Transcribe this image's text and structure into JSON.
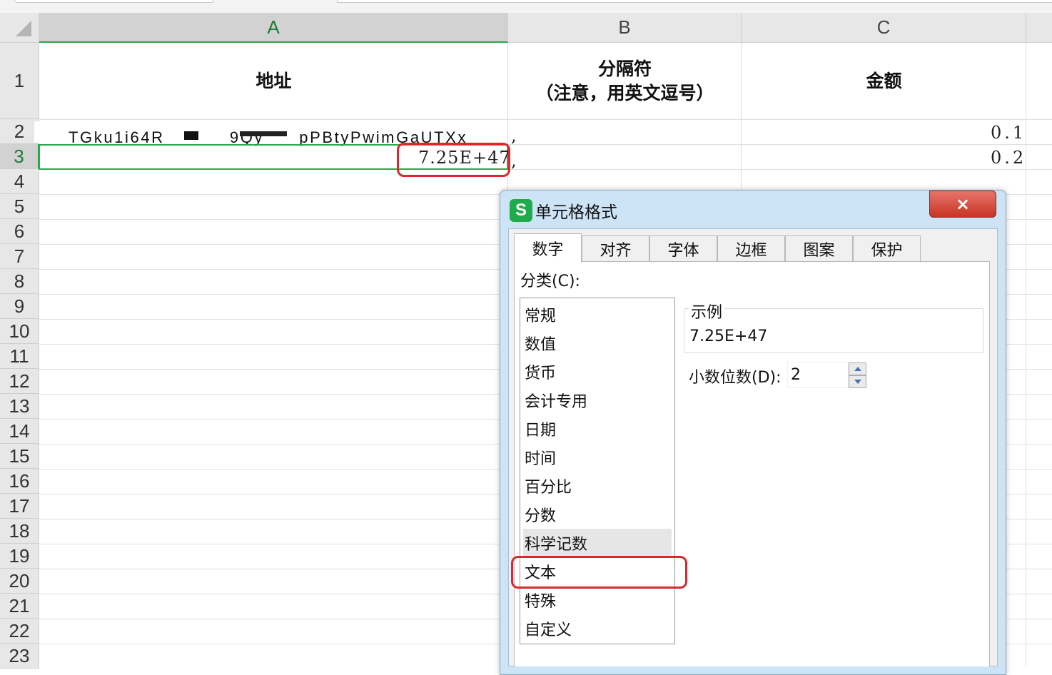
{
  "columns": [
    "A",
    "B",
    "C"
  ],
  "rows": [
    "1",
    "2",
    "3",
    "4",
    "5",
    "6",
    "7",
    "8",
    "9",
    "10",
    "11",
    "12",
    "13",
    "14",
    "15",
    "16",
    "17",
    "18",
    "19",
    "20",
    "21",
    "22",
    "23"
  ],
  "header_row": {
    "a": "地址",
    "b_line1": "分隔符",
    "b_line2": "（注意，用英文逗号）",
    "c": "金额"
  },
  "row2": {
    "a": "TGku1i64R　　 　 9Qy　　pPBtyPwimGaUTXx",
    "b": ",",
    "c": "0.1"
  },
  "row3": {
    "a": "7.25E+47",
    "b": ",",
    "c": "0.2"
  },
  "dialog": {
    "title": "单元格格式",
    "app_icon": "S",
    "close_icon": "×",
    "tabs": [
      "数字",
      "对齐",
      "字体",
      "边框",
      "图案",
      "保护"
    ],
    "active_tab": "数字",
    "category_label": "分类(C):",
    "categories": [
      "常规",
      "数值",
      "货币",
      "会计专用",
      "日期",
      "时间",
      "百分比",
      "分数",
      "科学记数",
      "文本",
      "特殊",
      "自定义"
    ],
    "selected_category": "科学记数",
    "sample_label": "示例",
    "sample_value": "7.25E+47",
    "decimal_label": "小数位数(D):",
    "decimal_value": "2"
  },
  "colors": {
    "selection_green": "#2ba84a",
    "highlight_red": "#e0262d",
    "dialog_frame": "#cde3f6"
  }
}
